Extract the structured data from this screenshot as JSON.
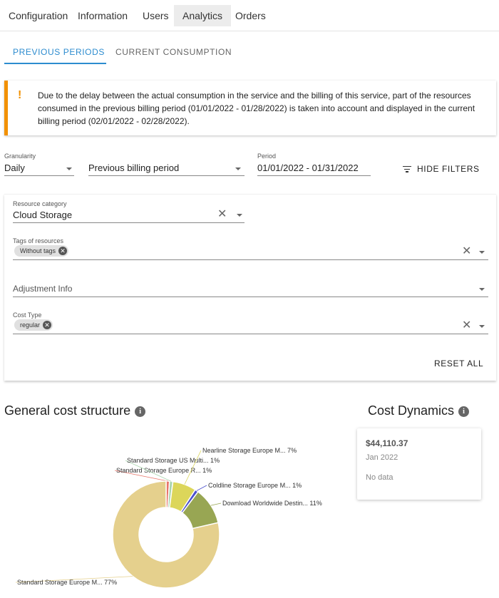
{
  "topnav": {
    "items": [
      {
        "label": "Configuration",
        "active": false
      },
      {
        "label": "Information",
        "active": false
      },
      {
        "label": "Users",
        "active": false
      },
      {
        "label": "Analytics",
        "active": true
      },
      {
        "label": "Orders",
        "active": false
      }
    ]
  },
  "subtabs": [
    {
      "label": "PREVIOUS PERIODS",
      "active": true
    },
    {
      "label": "CURRENT CONSUMPTION",
      "active": false
    }
  ],
  "alert": {
    "icon": "exclamation-icon",
    "text": "Due to the delay between the actual consumption in the service and the billing of this service, part of the resources consumed in the previous billing period (01/01/2022 - 01/28/2022) is taken into account and displayed in the current billing period (02/01/2022 - 02/28/2022)."
  },
  "filters": {
    "granularity": {
      "label": "Granularity",
      "value": "Daily"
    },
    "period_type": {
      "label": "",
      "value": "Previous billing period"
    },
    "period": {
      "label": "Period",
      "value": "01/01/2022 - 01/31/2022"
    },
    "hide_filters_label": "HIDE FILTERS"
  },
  "panel": {
    "resource_category": {
      "label": "Resource category",
      "value": "Cloud Storage"
    },
    "tags": {
      "label": "Tags of resources",
      "chips": [
        "Without tags"
      ]
    },
    "adjustment": {
      "placeholder": "Adjustment Info"
    },
    "cost_type": {
      "label": "Cost Type",
      "chips": [
        "regular"
      ]
    },
    "reset_label": "RESET ALL"
  },
  "general_cost": {
    "title": "General cost structure"
  },
  "cost_dynamics": {
    "title": "Cost Dynamics",
    "amount": "$44,110.37",
    "month": "Jan 2022",
    "no_data": "No data"
  },
  "chart_data": {
    "type": "pie",
    "donut": true,
    "slices": [
      {
        "label": "Standard Storage Europe M...",
        "value": 77,
        "display": "Standard Storage Europe M... 77%",
        "color": "#e5d08d"
      },
      {
        "label": "Standard Storage Europe R...",
        "value": 1,
        "display": "Standard Storage Europe R... 1%",
        "color": "#e8756a"
      },
      {
        "label": "Standard Storage US Multi...",
        "value": 1,
        "display": "Standard Storage US Multi... 1%",
        "color": "#a9d4ad"
      },
      {
        "label": "Nearline Storage Europe M...",
        "value": 7,
        "display": "Nearline Storage Europe M... 7%",
        "color": "#dcd65a"
      },
      {
        "label": "Coldline Storage Europe M...",
        "value": 1,
        "display": "Coldline Storage Europe M... 1%",
        "color": "#4a4fcc"
      },
      {
        "label": "Download Worldwide Destin...",
        "value": 11,
        "display": "Download Worldwide Destin... 11%",
        "color": "#98a653"
      }
    ]
  }
}
